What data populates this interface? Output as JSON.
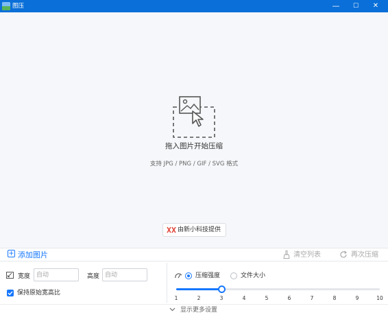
{
  "window": {
    "title": "图压",
    "minimize_glyph": "—",
    "maximize_glyph": "☐",
    "close_glyph": "✕"
  },
  "dropzone": {
    "icon": "image-drop-icon",
    "title": "拖入图片开始压缩",
    "hint": "支持 JPG / PNG / GIF / SVG 格式",
    "credit": "由新小科技提供"
  },
  "toolbar": {
    "add_label": "添加图片",
    "clear_label": "清空列表",
    "recompress_label": "再次压缩"
  },
  "settings": {
    "width_label": "宽度",
    "width_placeholder": "自动",
    "height_label": "高度",
    "height_placeholder": "自动",
    "keep_ratio_label": "保持原始宽高比",
    "keep_ratio_checked": true,
    "mode_options": [
      "压缩强度",
      "文件大小"
    ],
    "mode_selected": "压缩强度",
    "strength": {
      "min": 1,
      "max": 10,
      "value": 3,
      "ticks": [
        "1",
        "2",
        "3",
        "4",
        "5",
        "6",
        "7",
        "8",
        "9",
        "10"
      ]
    },
    "more_label": "显示更多设置"
  },
  "colors": {
    "titlebar": "#0a6fd8",
    "accent": "#1677ff",
    "dropzone_bg": "#f6f7fa",
    "disabled_text": "#aaaaaa"
  }
}
